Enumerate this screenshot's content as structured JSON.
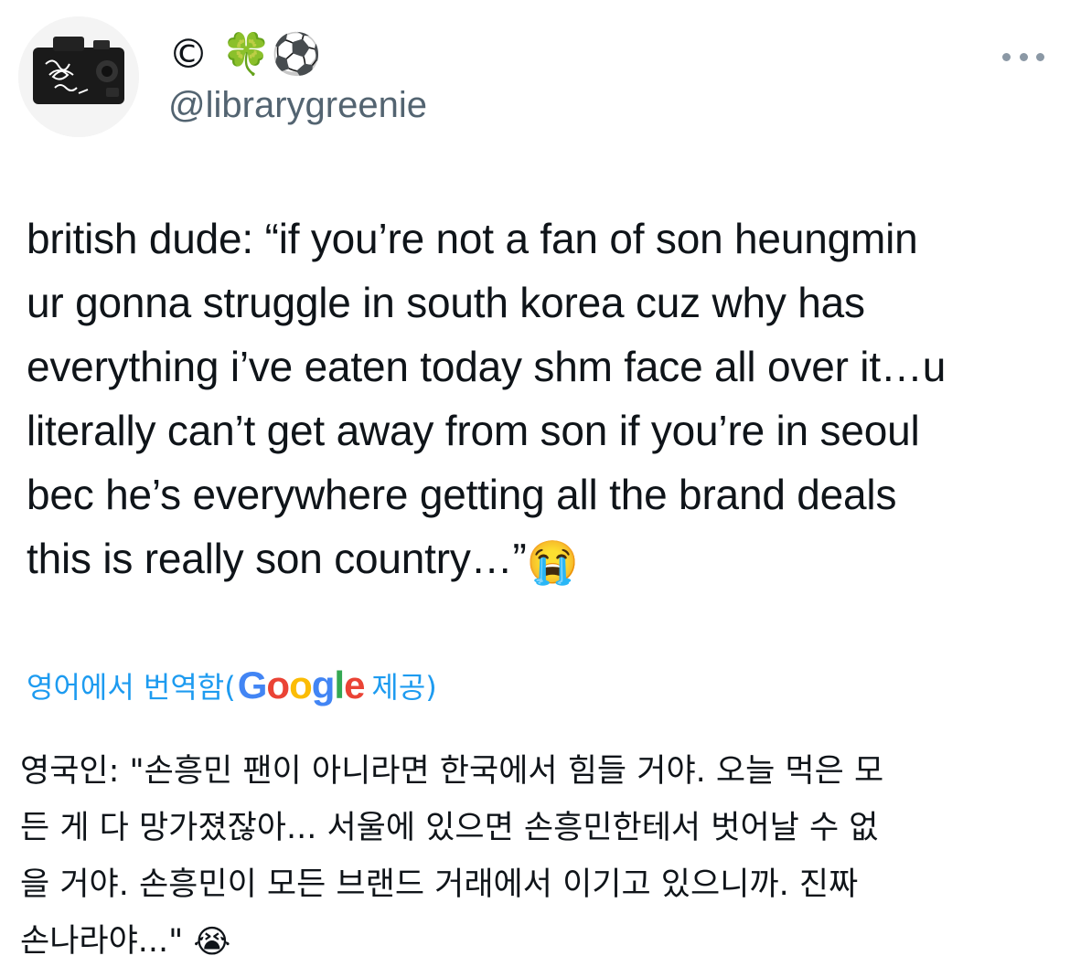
{
  "author": {
    "display_name": "© 🍀⚽",
    "handle": "@librarygreenie",
    "avatar_icon": "camera-avatar"
  },
  "more_icon": "more-options-icon",
  "tweet": {
    "lines": [
      "british dude: “if you’re not a fan of son heungmin",
      "ur gonna struggle in south korea cuz why has",
      "everything i’ve eaten today shm face all over it…u",
      "literally can’t get away from son if you’re in seoul",
      "bec he’s everywhere getting all the brand deals",
      "this is really son country…”"
    ],
    "emoji": "😭"
  },
  "translation": {
    "prefix": "영어에서 번역함(",
    "google_letters": [
      "G",
      "o",
      "o",
      "g",
      "l",
      "e"
    ],
    "suffix": " 제공)",
    "lines": [
      "영국인: \"손흥민 팬이 아니라면 한국에서 힘들 거야. 오늘 먹은 모",
      "든 게 다 망가졌잖아... 서울에 있으면 손흥민한테서 벗어날 수 없",
      "을 거야. 손흥민이 모든 브랜드 거래에서 이기고 있으니까. 진짜",
      "손나라야...\""
    ],
    "emoji": "😭"
  },
  "colors": {
    "text": "#0f1419",
    "secondary": "#536471",
    "link": "#1d9bf0"
  }
}
